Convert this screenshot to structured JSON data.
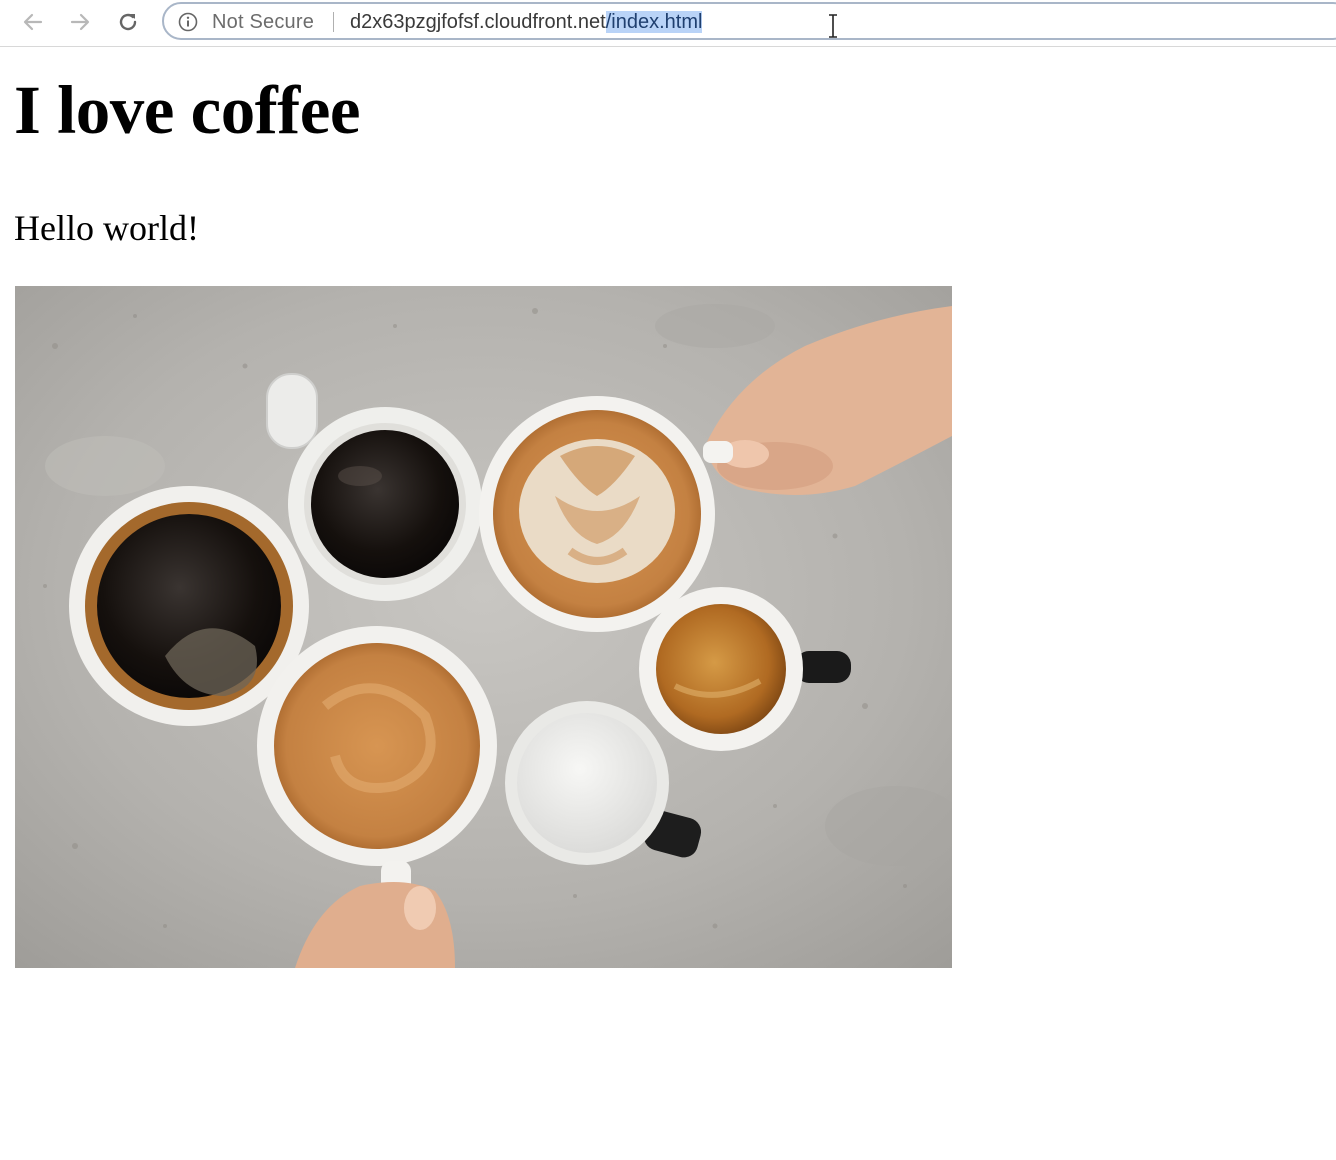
{
  "browser": {
    "security_label": "Not Secure",
    "url_host": "d2x63pzgjfofsf.cloudfront.net",
    "url_path": "/index.html",
    "icons": {
      "back": "arrow-left-icon",
      "forward": "arrow-right-icon",
      "reload": "reload-icon",
      "security": "info-circle-icon",
      "cursor": "text-cursor-icon"
    }
  },
  "page": {
    "heading": "I love coffee",
    "paragraph": "Hello world!",
    "image": {
      "subject": "coffee-cups-photo"
    }
  },
  "colors": {
    "selection": "#b9d3f7",
    "omnibox_border": "#a9b6c8"
  }
}
